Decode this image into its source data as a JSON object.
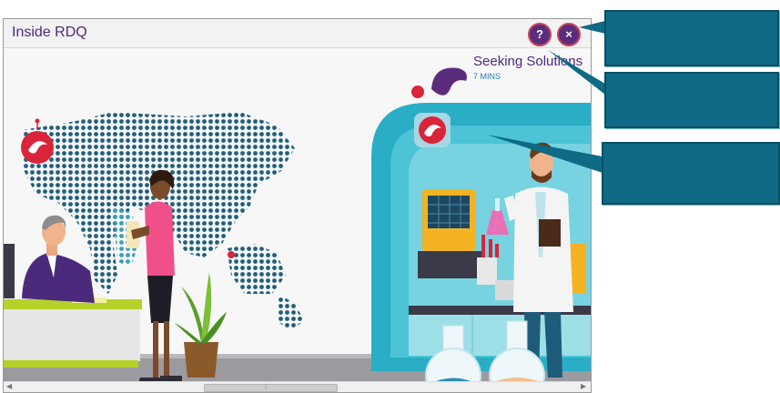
{
  "window": {
    "title": "Inside RDQ",
    "help_label": "?",
    "close_label": "×"
  },
  "scene": {
    "hotspot_title": "Seeking Solutions",
    "hotspot_duration": "7 MINS"
  },
  "colors": {
    "brand_purple": "#5b2c7c",
    "brand_red": "#d9243a",
    "callout_teal": "#0e6a85",
    "lab_teal": "#2aaec6"
  },
  "callouts": [
    "",
    "",
    ""
  ]
}
